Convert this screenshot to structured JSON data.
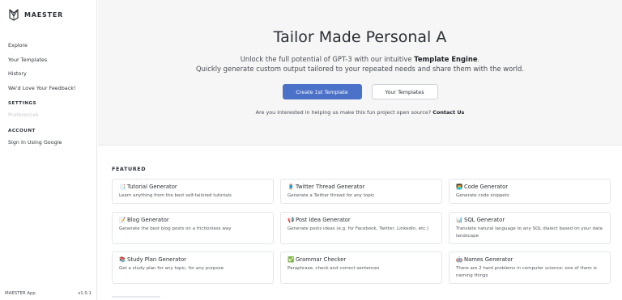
{
  "brand": {
    "name": "MAESTER"
  },
  "nav": {
    "explore": "Explore",
    "your_templates": "Your Templates",
    "history": "History",
    "feedback": "We'd Love Your Feedback!",
    "settings_heading": "SETTINGS",
    "preferences": "Preferences",
    "account_heading": "ACCOUNT",
    "sign_in": "Sign In Using Google"
  },
  "footer": {
    "app_name": "MAESTER App",
    "version": "v1.0.1"
  },
  "hero": {
    "title": "Tailor Made Personal A",
    "subtitle_prefix": "Unlock the full potential of GPT-3 with our intuitive ",
    "subtitle_bold": "Template Engine",
    "subtitle_suffix": ".",
    "subtitle_line2": "Quickly generate custom output tailored to your repeated needs and share them with the world.",
    "create_button": "Create 1st Template",
    "templates_button": "Your Templates",
    "question": "Are you interested in helping us make this fun project open source?",
    "contact_link": "Contact Us"
  },
  "featured": {
    "heading": "FEATURED",
    "cards": [
      {
        "icon": "📑",
        "icon_name": "bookmark-tabs-icon",
        "title": "Tutorial Generator",
        "desc": "Learn anything from the best self-tailored tutorials"
      },
      {
        "icon": "🧵",
        "icon_name": "thread-icon",
        "title": "Twitter Thread Generator",
        "desc": "Generate a Twitter thread for any topic"
      },
      {
        "icon": "👨‍💻",
        "icon_name": "technologist-icon",
        "title": "Code Generator",
        "desc": "Generate code snippets"
      },
      {
        "icon": "📝",
        "icon_name": "memo-icon",
        "title": "Blog Generator",
        "desc": "Generate the best blog posts on a frictionless way"
      },
      {
        "icon": "📢",
        "icon_name": "loudspeaker-icon",
        "title": "Post Idea Generator",
        "desc": "Generate posts ideas (e.g. for Facebook, Twitter, LinkedIn, etc.)"
      },
      {
        "icon": "📊",
        "icon_name": "bar-chart-icon",
        "title": "SQL Generator",
        "desc": "Translate natural language to any SQL dialect based on your data landscape"
      },
      {
        "icon": "📚",
        "icon_name": "books-icon",
        "title": "Study Plan Generator",
        "desc": "Get a study plan for any topic, for any purpose"
      },
      {
        "icon": "✅",
        "icon_name": "check-mark-icon",
        "title": "Grammar Checker",
        "desc": "Paraphrase, check and correct sentences"
      },
      {
        "icon": "🤖",
        "icon_name": "robot-icon",
        "title": "Names Generator",
        "desc": "There are 2 hard problems in computer science: one of them is naming things"
      }
    ]
  },
  "colors": {
    "primary": "#4b72c8",
    "hero_bg": "#f6f6f6",
    "text": "#2b2f36"
  }
}
